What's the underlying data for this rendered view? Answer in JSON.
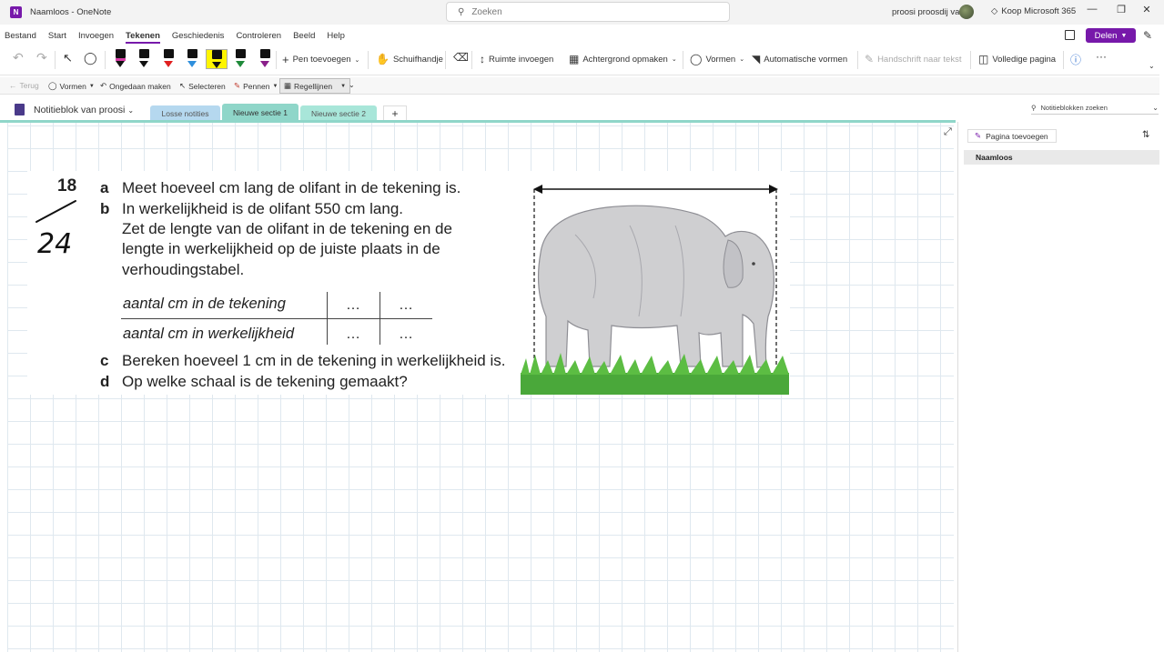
{
  "titlebar": {
    "app_logo": "N",
    "title": "Naamloos  -  OneNote",
    "search_placeholder": "Zoeken",
    "user_name": "proosi proosdij van",
    "buy": "Koop Microsoft 365",
    "minimize": "—",
    "restore": "❐",
    "close": "✕"
  },
  "menu": {
    "items": [
      "Bestand",
      "Start",
      "Invoegen",
      "Tekenen",
      "Geschiedenis",
      "Controleren",
      "Beeld",
      "Help"
    ],
    "active": "Tekenen",
    "share": "Delen"
  },
  "ribbon": {
    "add_pen": "Pen toevoegen",
    "pan": "Schuifhandje",
    "insert_space": "Ruimte invoegen",
    "background": "Achtergrond opmaken",
    "shapes": "Vormen",
    "auto_shapes": "Automatische vormen",
    "ink_to_text": "Handschrift naar tekst",
    "full_page": "Volledige pagina",
    "more": "···",
    "pens": [
      {
        "tip": "#111111",
        "band": "#d93ca8"
      },
      {
        "tip": "#111111",
        "band": "#ffffff"
      },
      {
        "tip": "#e02020",
        "band": "#ffffff"
      },
      {
        "tip": "#2f8fdc",
        "band": "#ffffff"
      },
      {
        "tip": "#111111",
        "band": "#fff500"
      },
      {
        "tip": "#1f8a3a",
        "band": "#ffffff"
      },
      {
        "tip": "#8a1f8a",
        "band": "#ffffff"
      }
    ]
  },
  "quickbar": {
    "back": "Terug",
    "shapes": "Vormen",
    "undo": "Ongedaan maken",
    "select": "Selecteren",
    "pens": "Pennen",
    "rule_lines": "Regellijnen"
  },
  "notebook": {
    "name": "Notitieblok van proosi",
    "tabs": [
      {
        "label": "Losse notities",
        "color": "#b5d8ef"
      },
      {
        "label": "Nieuwe sectie 1",
        "color": "#8fd6c9"
      },
      {
        "label": "Nieuwe sectie 2",
        "color": "#a8e6d9"
      }
    ],
    "add_tab": "+",
    "search": "Notitieblokken zoeken"
  },
  "exercise": {
    "number": "18",
    "handwriting": "24",
    "line_a": "Meet hoeveel cm lang de olifant in de tekening is.",
    "line_b1": "In werkelijkheid is de olifant 550 cm lang.",
    "line_b2": "Zet de lengte van de olifant in de tekening en de",
    "line_b3": "lengte in werkelijkheid op de juiste plaats in de",
    "line_b4": "verhoudingstabel.",
    "line_c": "Bereken hoeveel 1 cm in de tekening in werkelijkheid is.",
    "line_d": "Op welke schaal is de tekening gemaakt?",
    "letters": [
      "a",
      "b",
      "c",
      "d"
    ],
    "table": {
      "row1": "aantal cm in de tekening",
      "row2": "aantal cm in werkelijkheid",
      "cell": "…"
    }
  },
  "pagepane": {
    "add_page": "Pagina toevoegen",
    "pages": [
      "Naamloos"
    ]
  }
}
